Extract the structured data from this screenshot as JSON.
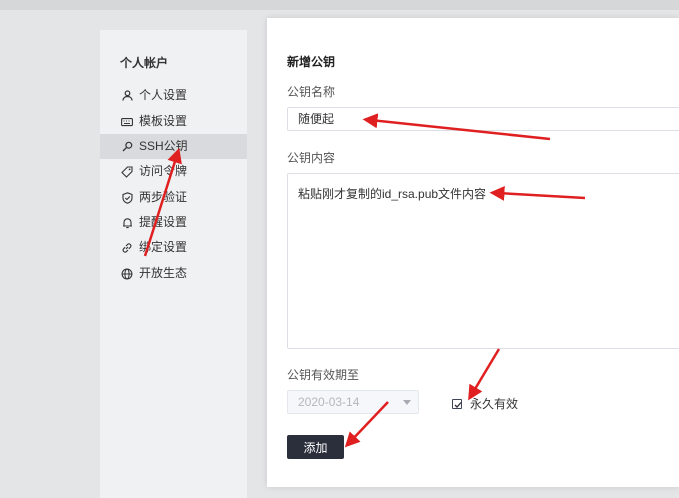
{
  "sidebar": {
    "title": "个人帐户",
    "items": [
      {
        "label": "个人设置",
        "icon": "user-icon"
      },
      {
        "label": "模板设置",
        "icon": "keyboard-icon"
      },
      {
        "label": "SSH公钥",
        "icon": "key-icon",
        "active": true
      },
      {
        "label": "访问令牌",
        "icon": "tag-icon"
      },
      {
        "label": "两步验证",
        "icon": "shield-check-icon"
      },
      {
        "label": "提醒设置",
        "icon": "bell-icon"
      },
      {
        "label": "绑定设置",
        "icon": "link-icon"
      },
      {
        "label": "开放生态",
        "icon": "globe-icon"
      }
    ]
  },
  "dialog": {
    "title": "新增公钥",
    "name_label": "公钥名称",
    "name_value": "随便起",
    "content_label": "公钥内容",
    "content_value": "粘贴刚才复制的id_rsa.pub文件内容",
    "expiry_label": "公钥有效期至",
    "expiry_value": "2020-03-14",
    "permanent_label": "永久有效",
    "permanent_checked": true,
    "add_label": "添加"
  },
  "colors": {
    "annotation_arrow": "#e02020",
    "primary_button": "#2a2f3b",
    "overlay_bg": "#e4e5e7"
  }
}
